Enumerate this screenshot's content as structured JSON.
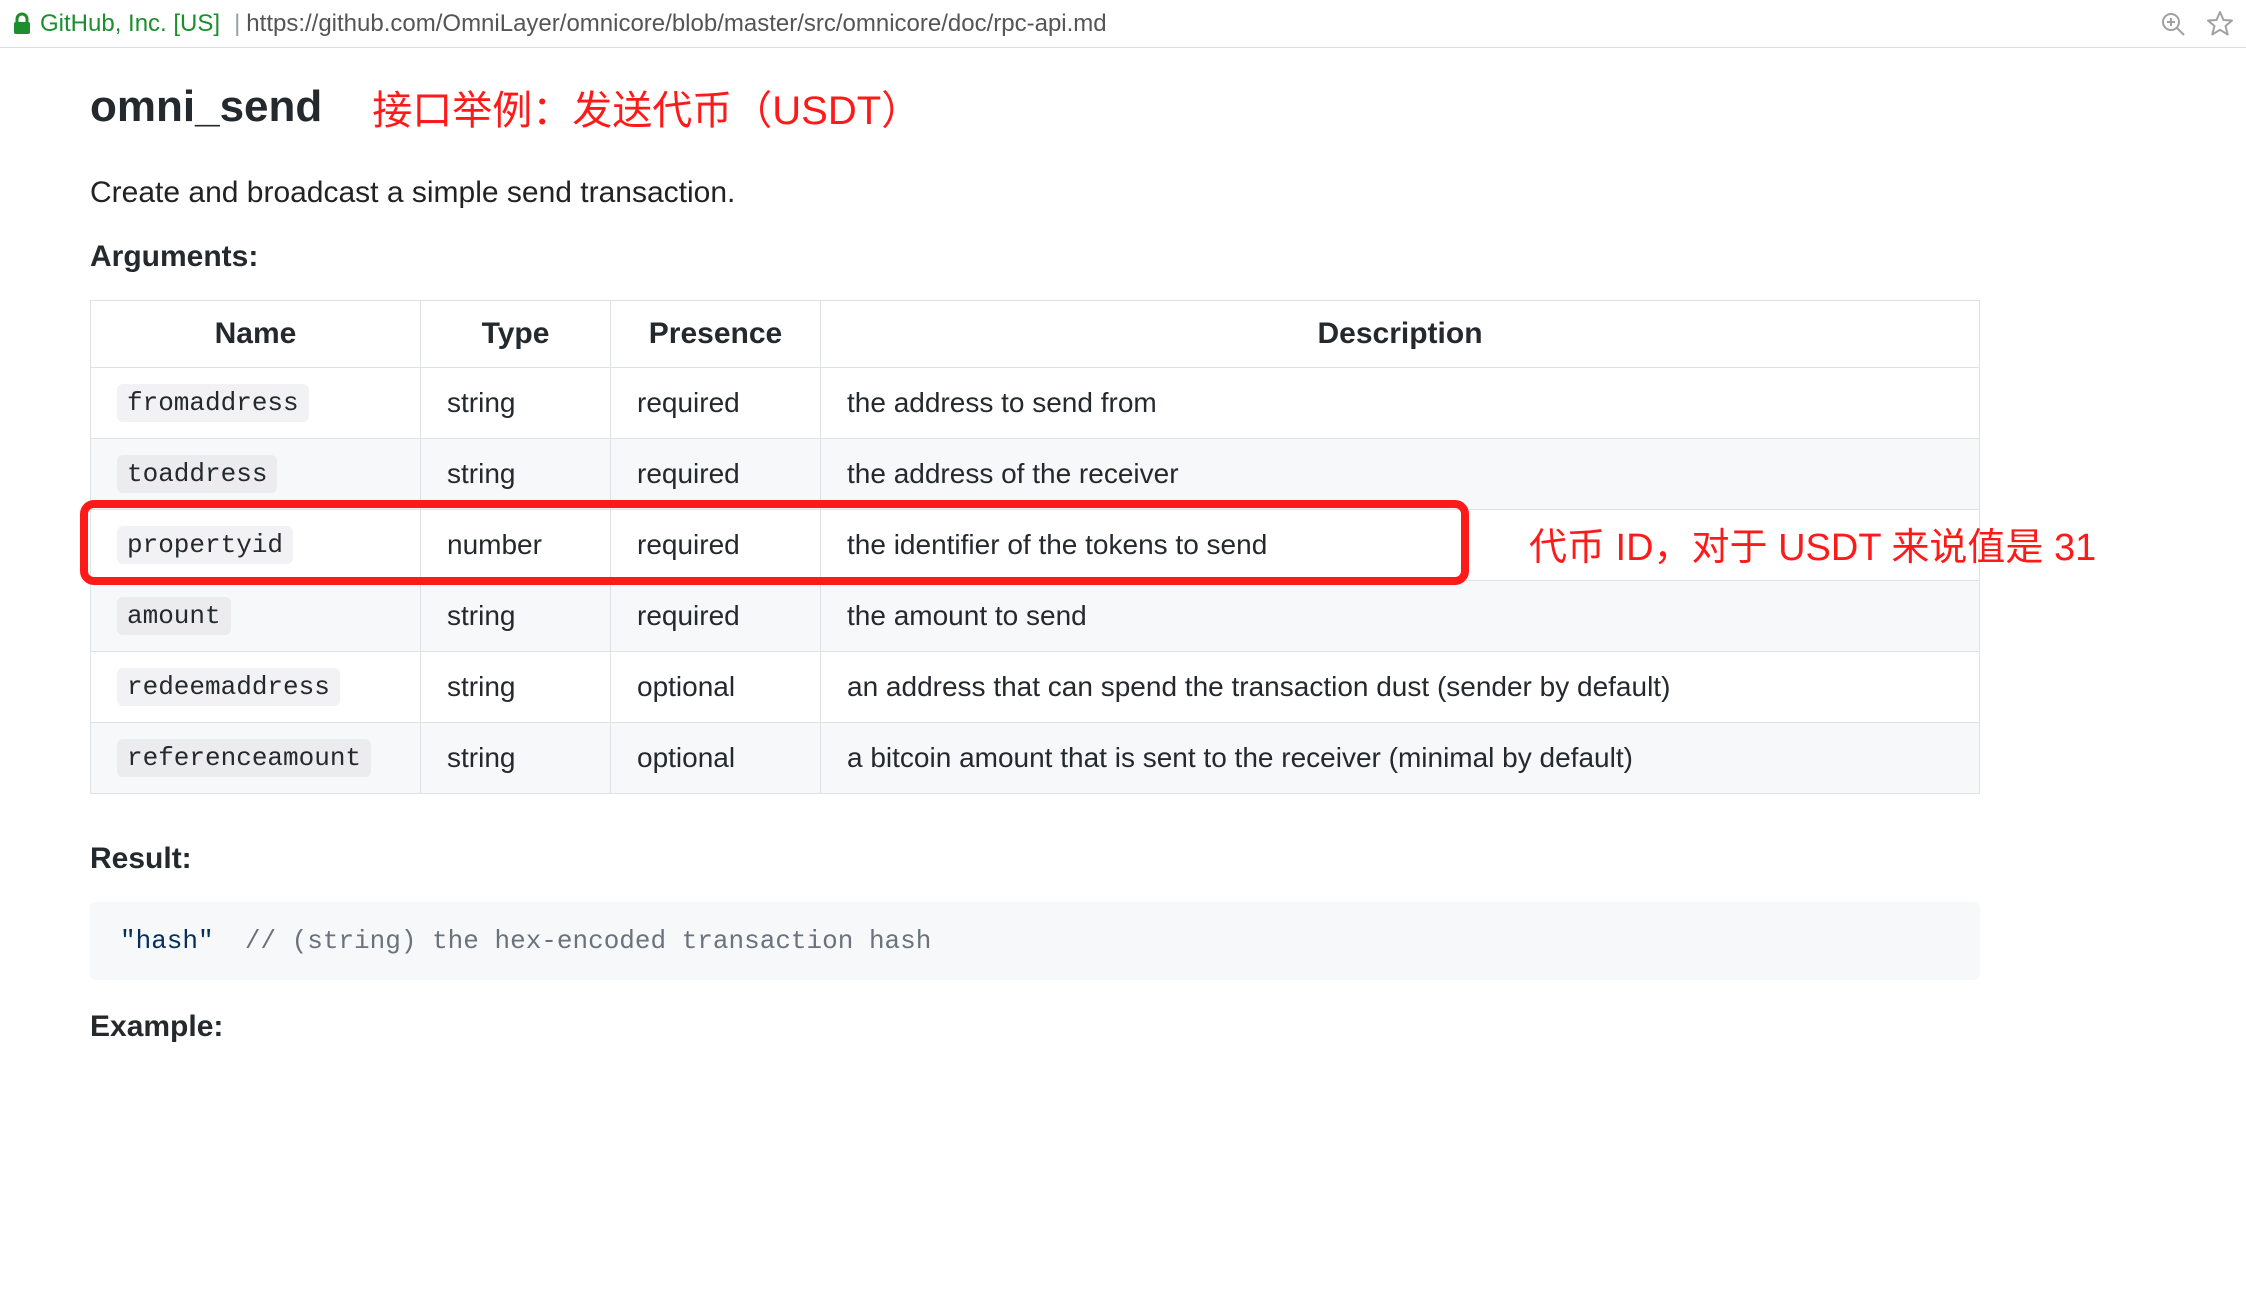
{
  "browser": {
    "site_identity": "GitHub, Inc. [US]",
    "url": "https://github.com/OmniLayer/omnicore/blob/master/src/omnicore/doc/rpc-api.md"
  },
  "heading": "omni_send",
  "heading_annotation": "接口举例：发送代币（USDT）",
  "description": "Create and broadcast a simple send transaction.",
  "arguments_label": "Arguments:",
  "columns": {
    "name": "Name",
    "type": "Type",
    "presence": "Presence",
    "description": "Description"
  },
  "args": [
    {
      "name": "fromaddress",
      "type": "string",
      "presence": "required",
      "description": "the address to send from"
    },
    {
      "name": "toaddress",
      "type": "string",
      "presence": "required",
      "description": "the address of the receiver"
    },
    {
      "name": "propertyid",
      "type": "number",
      "presence": "required",
      "description": "the identifier of the tokens to send"
    },
    {
      "name": "amount",
      "type": "string",
      "presence": "required",
      "description": "the amount to send"
    },
    {
      "name": "redeemaddress",
      "type": "string",
      "presence": "optional",
      "description": "an address that can spend the transaction dust (sender by default)"
    },
    {
      "name": "referenceamount",
      "type": "string",
      "presence": "optional",
      "description": "a bitcoin amount that is sent to the receiver (minimal by default)"
    }
  ],
  "row_highlight_index": 2,
  "side_annotation": "代币 ID，对于 USDT 来说值是 31",
  "result_label": "Result:",
  "result_code": {
    "string": "\"hash\"",
    "comment": "// (string) the hex-encoded transaction hash"
  },
  "example_label": "Example:"
}
